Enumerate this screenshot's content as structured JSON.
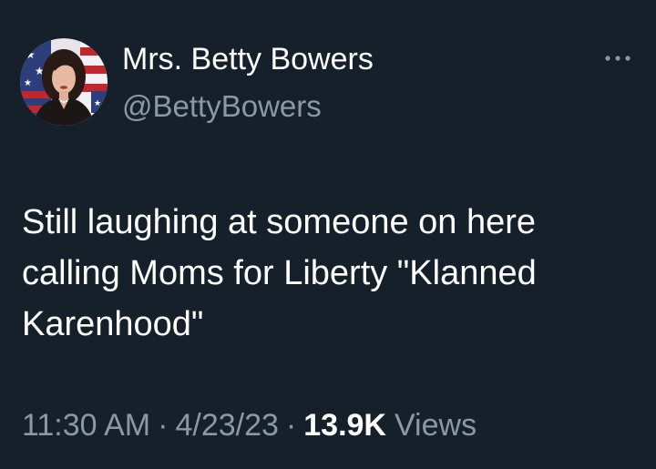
{
  "author": {
    "display_name": "Mrs. Betty Bowers",
    "handle": "@BettyBowers",
    "avatar_icon": "profile-photo-flag"
  },
  "more_icon": "ellipsis-icon",
  "tweet": {
    "text": "Still laughing at someone on here calling Moms for Liberty \"Klanned Karenhood\""
  },
  "meta": {
    "time": "11:30 AM",
    "separator": "·",
    "date": "4/23/23",
    "views_count": "13.9K",
    "views_label": "Views"
  },
  "colors": {
    "background": "#15202b",
    "primary_text": "#ffffff",
    "secondary_text": "#8b98a5"
  }
}
